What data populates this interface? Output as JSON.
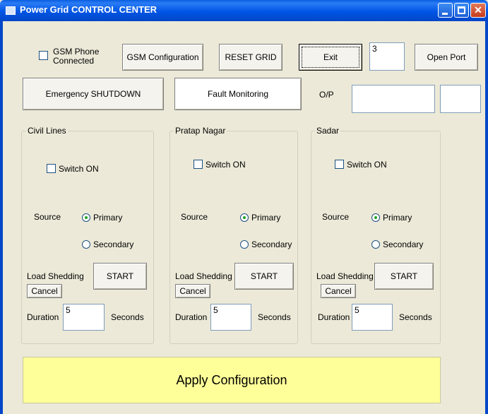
{
  "window": {
    "title": "Power Grid CONTROL CENTER"
  },
  "top": {
    "gsm_phone_label_1": "GSM Phone",
    "gsm_phone_label_2": "Connected",
    "gsm_config": "GSM Configuration",
    "reset_grid": "RESET GRID",
    "exit": "Exit",
    "port_value": "3",
    "open_port": "Open Port",
    "emergency_shutdown": "Emergency SHUTDOWN",
    "fault_monitoring": "Fault Monitoring",
    "op_label": "O/P",
    "op_value_1": "",
    "op_value_2": ""
  },
  "areas": [
    {
      "name": "Civil Lines",
      "switch_label": "Switch ON",
      "source_label": "Source",
      "primary": "Primary",
      "secondary": "Secondary",
      "load_shedding": "Load Shedding",
      "start": "START",
      "cancel": "Cancel",
      "duration_label": "Duration",
      "duration_value": "5",
      "seconds": "Seconds"
    },
    {
      "name": "Pratap Nagar",
      "switch_label": "Switch ON",
      "source_label": "Source",
      "primary": "Primary",
      "secondary": "Secondary",
      "load_shedding": "Load Shedding",
      "start": "START",
      "cancel": "Cancel",
      "duration_label": "Duration",
      "duration_value": "5",
      "seconds": "Seconds"
    },
    {
      "name": "Sadar",
      "switch_label": "Switch ON",
      "source_label": "Source",
      "primary": "Primary",
      "secondary": "Secondary",
      "load_shedding": "Load Shedding",
      "start": "START",
      "cancel": "Cancel",
      "duration_label": "Duration",
      "duration_value": "5",
      "seconds": "Seconds"
    }
  ],
  "apply": "Apply Configuration",
  "colors": {
    "titlebar": "#0055E5",
    "apply_bg": "#FFFF99",
    "window_bg": "#ECE9D8"
  }
}
